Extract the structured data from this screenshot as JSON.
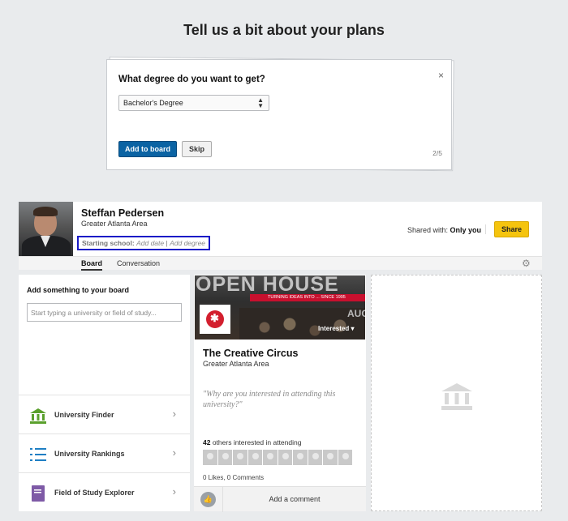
{
  "page": {
    "title": "Tell us a bit about your plans"
  },
  "modal": {
    "close_label": "×",
    "question": "What degree do you want to get?",
    "degree_selected": "Bachelor's Degree",
    "add_button": "Add to board",
    "skip_button": "Skip",
    "step": "2/5"
  },
  "profile": {
    "name": "Steffan Pedersen",
    "location": "Greater Atlanta Area",
    "starting_school_label": "Starting school:",
    "add_date": "Add date",
    "separator": "|",
    "add_degree": "Add degree",
    "shared_label": "Shared with:",
    "shared_value": "Only you",
    "share_button": "Share",
    "tabs": [
      {
        "label": "Board"
      },
      {
        "label": "Conversation"
      }
    ]
  },
  "left_panel": {
    "title": "Add something to your board",
    "search_placeholder": "Start typing a university or field of study...",
    "tools": [
      {
        "label": "University Finder",
        "icon": "bank-icon"
      },
      {
        "label": "University Rankings",
        "icon": "list-icon"
      },
      {
        "label": "Field of Study Explorer",
        "icon": "book-icon"
      }
    ]
  },
  "card": {
    "image_headline": "OPEN HOUSE",
    "image_banner": "TURNING IDEAS INTO ... SINCE 1995",
    "image_aug": "AUG",
    "interested_label": "Interested ▾",
    "name": "The Creative Circus",
    "location": "Greater Atlanta Area",
    "quote": "\"Why are you interested in attending this university?\"",
    "others_count": "42",
    "others_text": " others interested in attending",
    "likes_comments": "0 Likes, 0 Comments",
    "add_comment": "Add a comment"
  },
  "colors": {
    "accent_blue": "#0b63a3",
    "share_yellow": "#f5c40e",
    "highlight_border": "#1a1ac7"
  }
}
